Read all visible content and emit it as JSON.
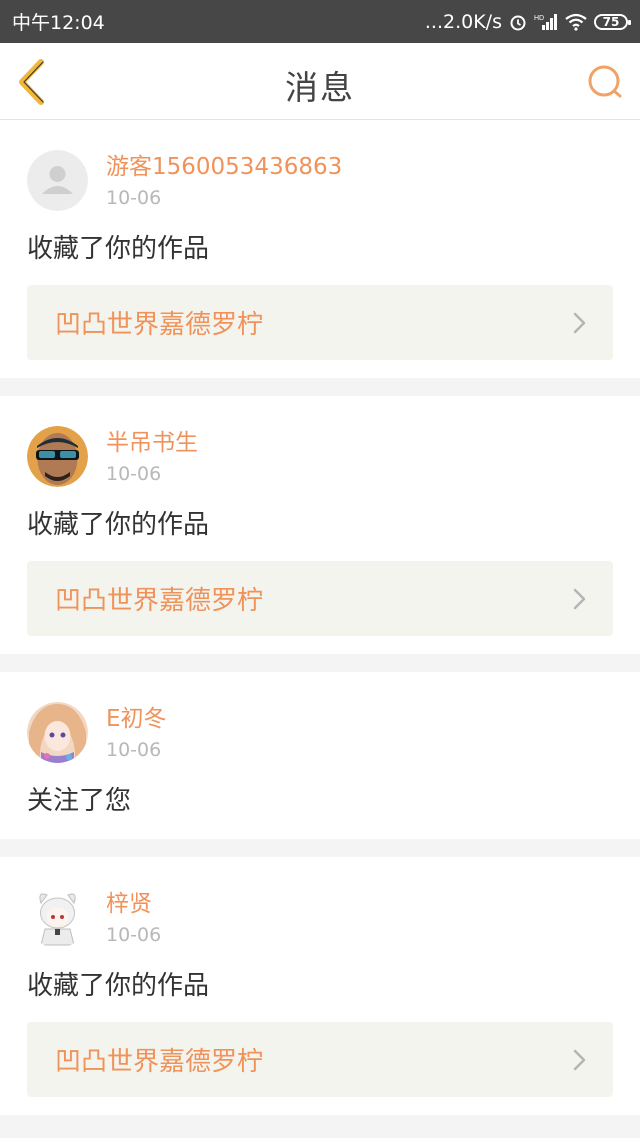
{
  "status_bar": {
    "time": "中午12:04",
    "network_speed": "...2.0K/s",
    "battery": "75"
  },
  "header": {
    "title": "消息",
    "back_icon": "chevron-left-icon",
    "search_icon": "search-icon"
  },
  "messages": [
    {
      "username": "游客1560053436863",
      "date": "10-06",
      "action": "收藏了你的作品",
      "work_title": "凹凸世界嘉德罗柠",
      "avatar": "default-avatar"
    },
    {
      "username": "半吊书生",
      "date": "10-06",
      "action": "收藏了你的作品",
      "work_title": "凹凸世界嘉德罗柠",
      "avatar": "sunglasses-avatar"
    },
    {
      "username": "E初冬",
      "date": "10-06",
      "action": "关注了您",
      "avatar": "anime-avatar"
    },
    {
      "username": "梓贤",
      "date": "10-06",
      "action": "收藏了你的作品",
      "work_title": "凹凸世界嘉德罗柠",
      "avatar": "chibi-avatar"
    }
  ],
  "colors": {
    "accent": "#f0935a",
    "status_bar_bg": "#474747",
    "work_bg": "#f4f4ef"
  }
}
